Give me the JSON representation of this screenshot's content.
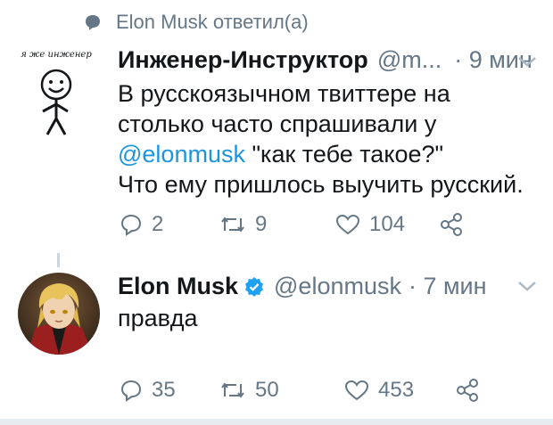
{
  "reply_context": {
    "text": "Elon Musk ответил(а)",
    "icon": "chat-bubble-icon"
  },
  "tweet1": {
    "avatar_caption": "я же инженер",
    "author_name": "Инженер-Инструктор",
    "handle": "@m...",
    "time": "· 9 мин",
    "text_line1": "В русскоязычном твиттере на",
    "text_line2": "столько часто спрашивали у",
    "mention": "@elonmusk",
    "text_line3_rest": " \"как тебе такое?\"",
    "text_line4": "Что ему пришлось выучить русский.",
    "stats": {
      "replies": "2",
      "retweets": "9",
      "likes": "104"
    }
  },
  "tweet2": {
    "author_name": "Elon Musk",
    "verified": true,
    "handle": "@elonmusk",
    "time": "· 7 мин",
    "text": "правда",
    "stats": {
      "replies": "35",
      "retweets": "50",
      "likes": "453"
    }
  },
  "colors": {
    "link": "#1b95e0",
    "muted": "#657786",
    "verified": "#1da1f2",
    "divider": "#e6ecf0"
  }
}
